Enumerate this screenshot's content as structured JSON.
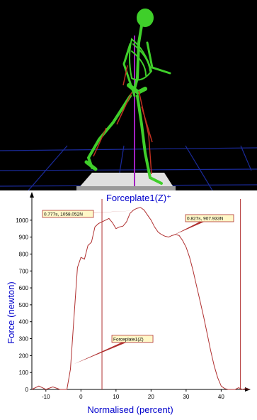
{
  "viewport": {
    "background": "#000000",
    "floor_grid_color": "#1a2a9a",
    "skeleton_color": "#3fcf2a",
    "muscle_color": "#c03020",
    "force_vector_color": "#a020c0",
    "plate_color": "#d8d8d8"
  },
  "chart_data": {
    "type": "line",
    "title": "Forceplate1(Z)⁺",
    "xlabel": "Normalised (percent)",
    "ylabel": "Force (newton)",
    "xlim": [
      -14,
      48
    ],
    "ylim": [
      0,
      1100
    ],
    "xticks": [
      -10,
      0,
      10,
      20,
      30,
      40
    ],
    "yticks": [
      0,
      100,
      200,
      300,
      400,
      500,
      600,
      700,
      800,
      900,
      1000
    ],
    "title_color": "#0000cc",
    "axis_label_color": "#0000cc",
    "line_color": "#b03030",
    "marker_lines_x": [
      6,
      45.5
    ],
    "series": [
      {
        "name": "Forceplate1(Z)",
        "x": [
          -14,
          -12,
          -10,
          -8,
          -6,
          -4,
          -3,
          -2,
          -1,
          0,
          1,
          2,
          3,
          4,
          5,
          6,
          7,
          8,
          9,
          10,
          11,
          12,
          13,
          14,
          15,
          16,
          17,
          18,
          19,
          20,
          21,
          22,
          23,
          24,
          25,
          26,
          27,
          28,
          29,
          30,
          31,
          32,
          33,
          34,
          35,
          36,
          37,
          38,
          39,
          40,
          41,
          42,
          43,
          44,
          45,
          46,
          47,
          48
        ],
        "y": [
          0,
          20,
          0,
          15,
          0,
          0,
          120,
          420,
          720,
          780,
          770,
          850,
          870,
          960,
          980,
          990,
          1000,
          1010,
          985,
          950,
          960,
          965,
          990,
          1040,
          1060,
          1070,
          1075,
          1060,
          1030,
          1000,
          960,
          930,
          915,
          905,
          900,
          910,
          915,
          910,
          880,
          840,
          780,
          700,
          610,
          520,
          430,
          330,
          230,
          140,
          70,
          20,
          5,
          0,
          0,
          0,
          10,
          0,
          5,
          0
        ]
      }
    ],
    "annotations": [
      {
        "text": "0.777s, 1058.052N",
        "x": 17,
        "y": 1058
      },
      {
        "text": "0.827s, 907.933N",
        "x": 26,
        "y": 908
      },
      {
        "text": "Forceplate1(Z)",
        "x": -2,
        "y": 150
      }
    ]
  }
}
